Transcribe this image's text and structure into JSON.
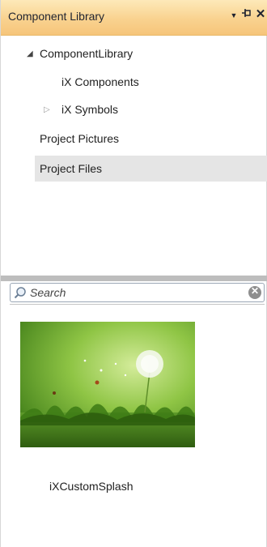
{
  "panel": {
    "title": "Component Library",
    "buttons": {
      "dropdown_icon": "chevron-down-icon",
      "pin_icon": "pin-icon",
      "close_icon": "close-icon"
    }
  },
  "tree": {
    "items": [
      {
        "label": "ComponentLibrary",
        "expanded": true
      },
      {
        "label": "iX Components"
      },
      {
        "label": "iX Symbols",
        "expanded": false
      },
      {
        "label": "Project Pictures"
      },
      {
        "label": "Project Files",
        "selected": true
      }
    ]
  },
  "search": {
    "placeholder": "Search",
    "value": ""
  },
  "library_items": [
    {
      "label": "iXCustomSplash",
      "thumbnail": "green-grass-dandelion-image"
    }
  ],
  "colors": {
    "titlebar": "#f9d28f",
    "selected_row": "#e5e5e5",
    "splitter": "#bdbdbd"
  }
}
